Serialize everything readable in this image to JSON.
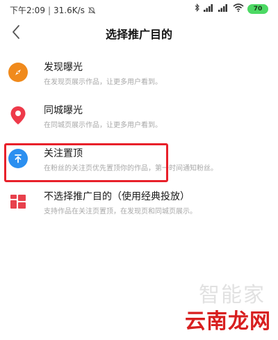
{
  "status_bar": {
    "time": "下午2:09",
    "separator": "|",
    "network_speed": "31.6K/s",
    "battery_level": "70",
    "battery_color": "#4cd964"
  },
  "header": {
    "title": "选择推广目的",
    "back_icon": "chevron-left-icon"
  },
  "options": [
    {
      "title": "发现曝光",
      "description": "在发现页展示作品，让更多用户看到。",
      "icon": "compass-icon",
      "color": "#f08a1c"
    },
    {
      "title": "同城曝光",
      "description": "在同城页展示作品，让更多用户看到。",
      "icon": "location-pin-icon",
      "color": "#ee3a4a"
    },
    {
      "title": "关注置顶",
      "description": "在粉丝的关注页优先置顶你的作品，第一时间通知粉丝。",
      "icon": "pin-to-top-icon",
      "color": "#2b8ff0",
      "highlighted": true
    },
    {
      "title": "不选择推广目的（使用经典投放）",
      "description": "支持作品在关注页置顶，在发现页和同城页展示。",
      "icon": "grid-icon",
      "color": "#e8404c"
    }
  ],
  "highlight_color": "#e8202a",
  "watermark": {
    "top_text": "智能家",
    "bottom_text": "云南龙网"
  }
}
